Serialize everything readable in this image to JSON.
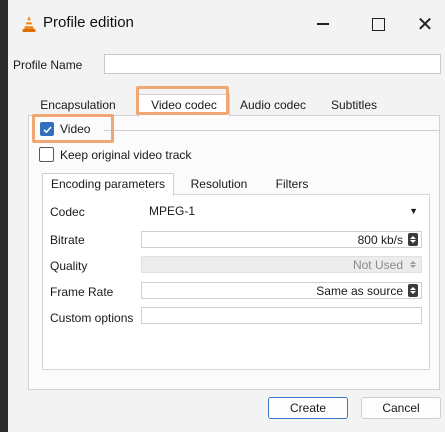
{
  "window": {
    "title": "Profile edition"
  },
  "profile": {
    "name_label": "Profile Name",
    "name_value": ""
  },
  "tabs": [
    {
      "label": "Encapsulation"
    },
    {
      "label": "Video codec",
      "selected": true
    },
    {
      "label": "Audio codec"
    },
    {
      "label": "Subtitles"
    }
  ],
  "video": {
    "enabled_label": "Video",
    "enabled": true,
    "keep_original_label": "Keep original video track",
    "keep_original": false
  },
  "subtabs": [
    {
      "label": "Encoding parameters",
      "selected": true
    },
    {
      "label": "Resolution"
    },
    {
      "label": "Filters"
    }
  ],
  "params": {
    "codec": {
      "label": "Codec",
      "value": "MPEG-1"
    },
    "bitrate": {
      "label": "Bitrate",
      "value": "800 kb/s"
    },
    "quality": {
      "label": "Quality",
      "value": "Not Used"
    },
    "frame_rate": {
      "label": "Frame Rate",
      "value": "Same as source"
    },
    "custom": {
      "label": "Custom options",
      "value": ""
    }
  },
  "buttons": {
    "create": "Create",
    "cancel": "Cancel"
  },
  "colors": {
    "highlight": "#f0a774",
    "checkbox": "#2f6fbd",
    "accent_border": "#3c78c3"
  }
}
